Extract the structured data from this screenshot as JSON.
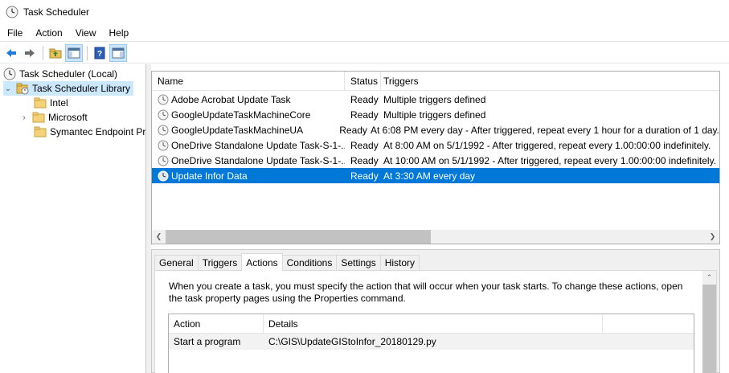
{
  "window": {
    "title": "Task Scheduler"
  },
  "menu": [
    "File",
    "Action",
    "View",
    "Help"
  ],
  "toolbar": {
    "buttons": [
      "back-arrow-icon",
      "forward-arrow-icon",
      "up-folder-icon",
      "show-hide-console-tree-icon",
      "help-icon",
      "show-hide-action-pane-icon"
    ]
  },
  "tree": {
    "root": "Task Scheduler (Local)",
    "library": "Task Scheduler Library",
    "children": [
      "Intel",
      "Microsoft",
      "Symantec Endpoint Pr"
    ]
  },
  "tasklist": {
    "columns": [
      "Name",
      "Status",
      "Triggers"
    ],
    "rows": [
      {
        "name": "Adobe Acrobat Update Task",
        "status": "Ready",
        "triggers": "Multiple triggers defined"
      },
      {
        "name": "GoogleUpdateTaskMachineCore",
        "status": "Ready",
        "triggers": "Multiple triggers defined"
      },
      {
        "name": "GoogleUpdateTaskMachineUA",
        "status": "Ready",
        "triggers": "At 6:08 PM every day - After triggered, repeat every 1 hour for a duration of 1 day."
      },
      {
        "name": "OneDrive Standalone Update Task-S-1-...",
        "status": "Ready",
        "triggers": "At 8:00 AM on 5/1/1992 - After triggered, repeat every 1.00:00:00 indefinitely."
      },
      {
        "name": "OneDrive Standalone Update Task-S-1-...",
        "status": "Ready",
        "triggers": "At 10:00 AM on 5/1/1992 - After triggered, repeat every 1.00:00:00 indefinitely."
      },
      {
        "name": "Update Infor Data",
        "status": "Ready",
        "triggers": "At 3:30 AM every day"
      }
    ],
    "selected_index": 5
  },
  "detail": {
    "tabs": [
      "General",
      "Triggers",
      "Actions",
      "Conditions",
      "Settings",
      "History"
    ],
    "active_tab": "Actions",
    "description": "When you create a task, you must specify the action that will occur when your task starts.  To change these actions, open the task property pages using the Properties command.",
    "actions": {
      "columns": [
        "Action",
        "Details"
      ],
      "rows": [
        {
          "action": "Start a program",
          "details": "C:\\GIS\\UpdateGIStoInfor_20180129.py"
        }
      ]
    }
  },
  "colors": {
    "selection": "#0078d7",
    "tree_selection": "#cce8ff"
  }
}
